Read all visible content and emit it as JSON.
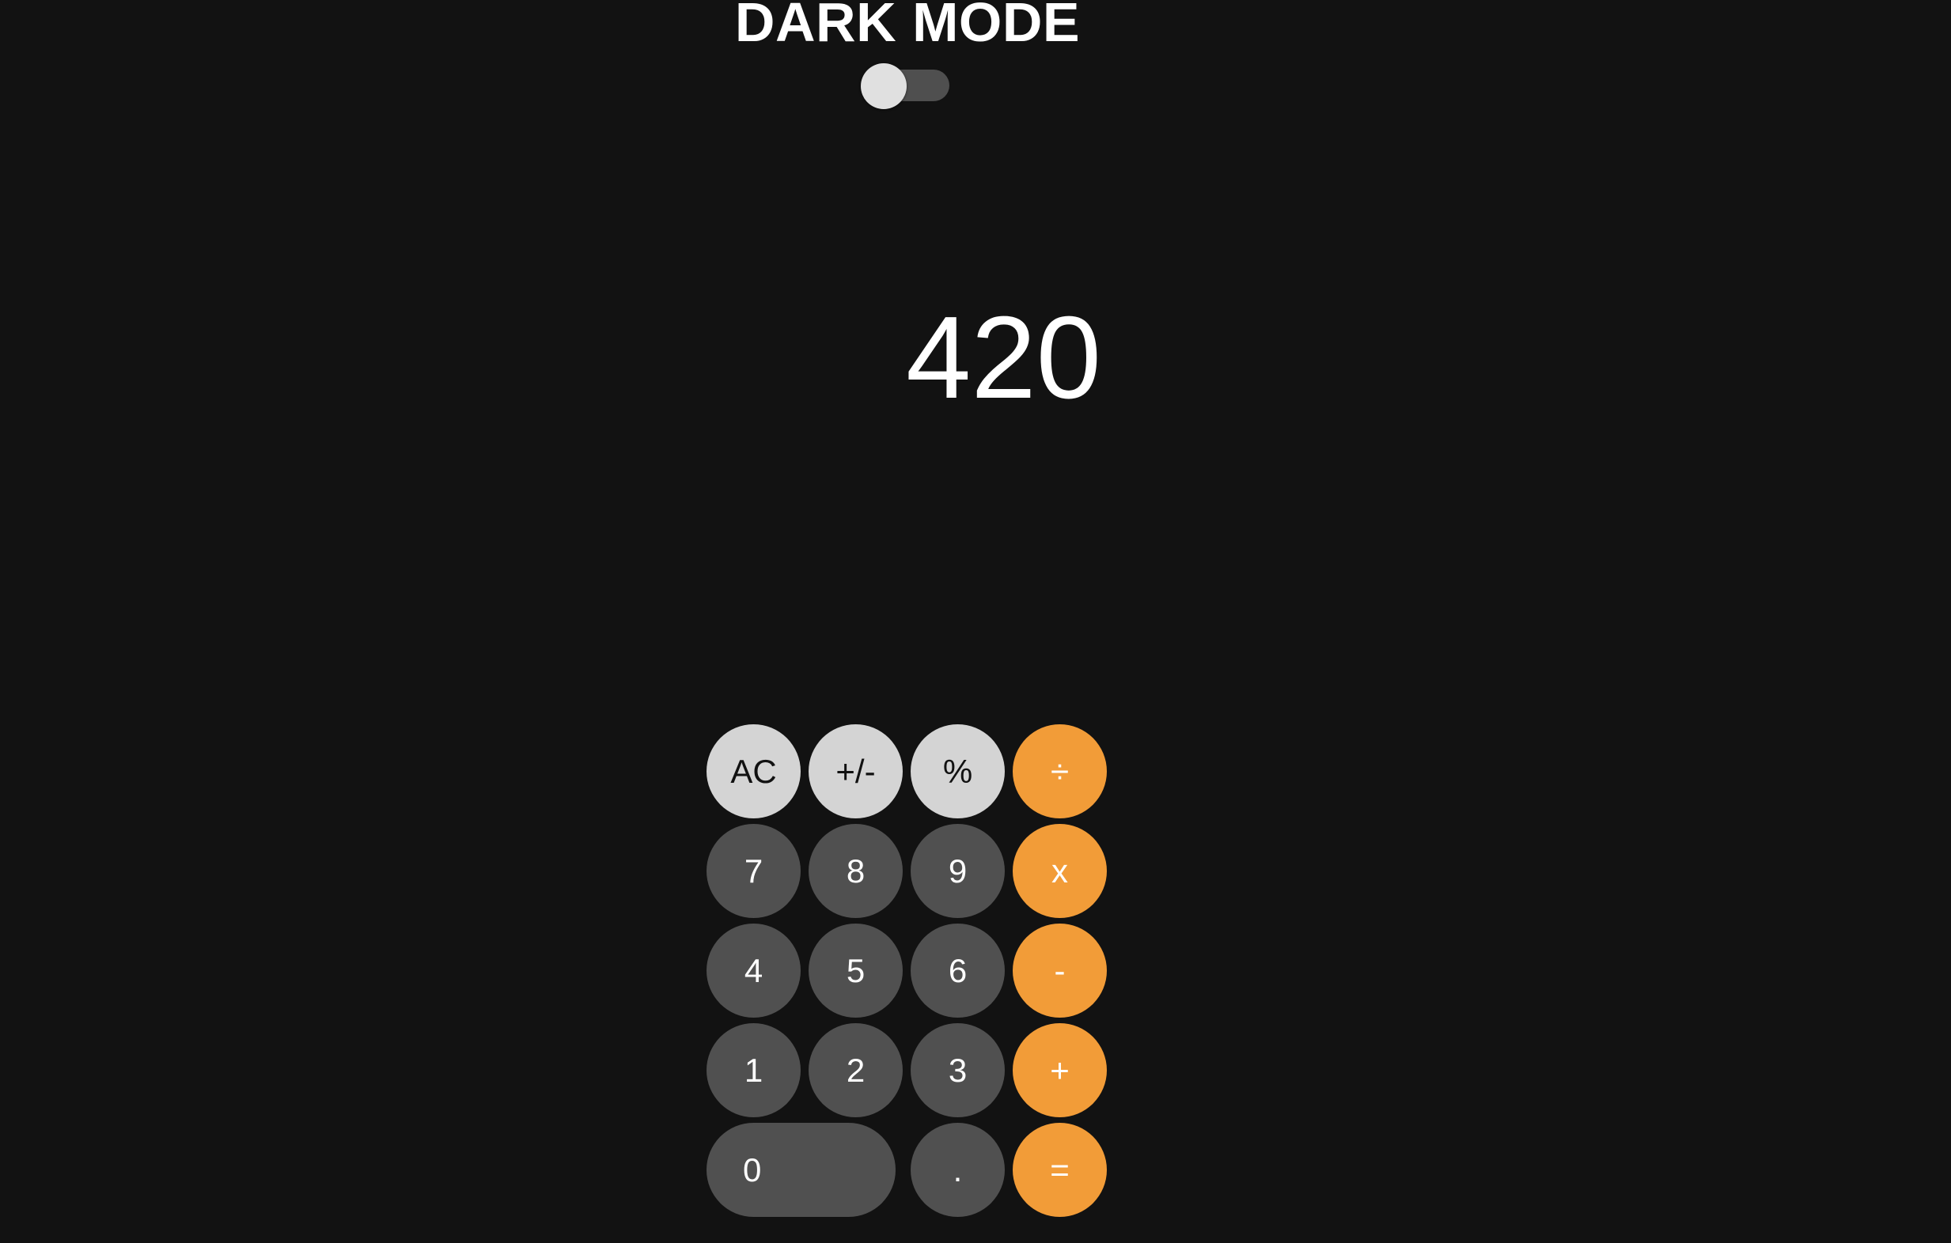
{
  "header": {
    "title": "DARK MODE",
    "toggle_on": false
  },
  "display": {
    "value": "420"
  },
  "keypad": {
    "rows": [
      [
        {
          "label": "AC",
          "kind": "fn",
          "name": "clear-button"
        },
        {
          "label": "+/-",
          "kind": "fn",
          "name": "sign-toggle-button"
        },
        {
          "label": "%",
          "kind": "fn",
          "name": "percent-button"
        },
        {
          "label": "÷",
          "kind": "op",
          "name": "divide-button"
        }
      ],
      [
        {
          "label": "7",
          "kind": "num",
          "name": "digit-7-button"
        },
        {
          "label": "8",
          "kind": "num",
          "name": "digit-8-button"
        },
        {
          "label": "9",
          "kind": "num",
          "name": "digit-9-button"
        },
        {
          "label": "x",
          "kind": "op",
          "name": "multiply-button"
        }
      ],
      [
        {
          "label": "4",
          "kind": "num",
          "name": "digit-4-button"
        },
        {
          "label": "5",
          "kind": "num",
          "name": "digit-5-button"
        },
        {
          "label": "6",
          "kind": "num",
          "name": "digit-6-button"
        },
        {
          "label": "-",
          "kind": "op",
          "name": "subtract-button"
        }
      ],
      [
        {
          "label": "1",
          "kind": "num",
          "name": "digit-1-button"
        },
        {
          "label": "2",
          "kind": "num",
          "name": "digit-2-button"
        },
        {
          "label": "3",
          "kind": "num",
          "name": "digit-3-button"
        },
        {
          "label": "+",
          "kind": "op",
          "name": "add-button"
        }
      ],
      [
        {
          "label": "0",
          "kind": "num",
          "name": "digit-0-button"
        },
        {
          "label": ".",
          "kind": "num",
          "name": "decimal-button"
        },
        {
          "label": "=",
          "kind": "op",
          "name": "equals-button"
        }
      ]
    ]
  },
  "colors": {
    "background": "#121212",
    "function_key": "#d4d4d4",
    "number_key": "#505050",
    "operator_key": "#f29c38"
  }
}
